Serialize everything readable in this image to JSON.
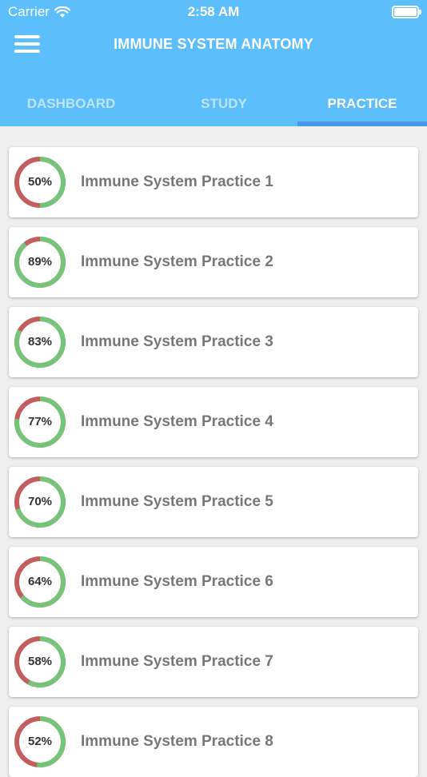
{
  "status_bar": {
    "carrier": "Carrier",
    "time": "2:58 AM"
  },
  "header": {
    "title": "IMMUNE SYSTEM ANATOMY"
  },
  "tabs": [
    {
      "label": "DASHBOARD",
      "active": false
    },
    {
      "label": "STUDY",
      "active": false
    },
    {
      "label": "PRACTICE",
      "active": true
    }
  ],
  "colors": {
    "header": "#5cbefb",
    "tab_indicator": "#4a98ee",
    "score_correct": "#75c47a",
    "score_incorrect": "#c45e5e"
  },
  "practice_items": [
    {
      "title": "Immune System Practice 1",
      "score_label": "50%",
      "score": 50
    },
    {
      "title": "Immune System Practice 2",
      "score_label": "89%",
      "score": 89
    },
    {
      "title": "Immune System Practice 3",
      "score_label": "83%",
      "score": 83
    },
    {
      "title": "Immune System Practice 4",
      "score_label": "77%",
      "score": 77
    },
    {
      "title": "Immune System Practice 5",
      "score_label": "70%",
      "score": 70
    },
    {
      "title": "Immune System Practice 6",
      "score_label": "64%",
      "score": 64
    },
    {
      "title": "Immune System Practice 7",
      "score_label": "58%",
      "score": 58
    },
    {
      "title": "Immune System Practice 8",
      "score_label": "52%",
      "score": 52
    }
  ]
}
